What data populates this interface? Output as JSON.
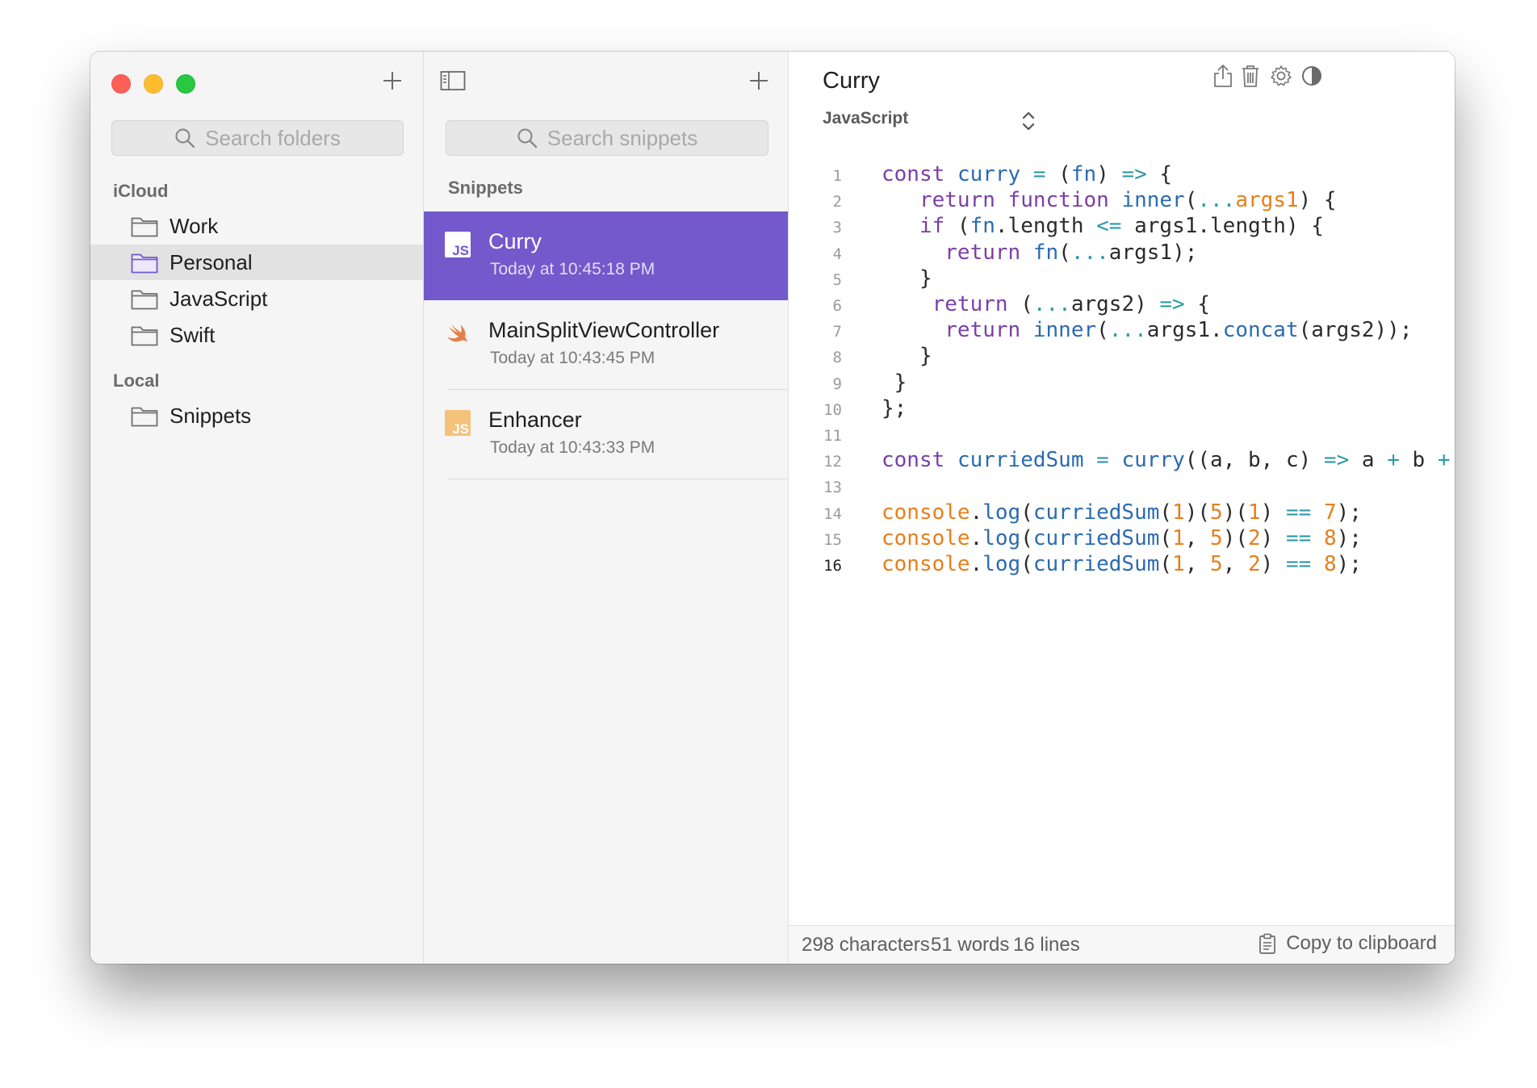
{
  "folders": {
    "search_placeholder": "Search folders",
    "icloud_label": "iCloud",
    "icloud_items": [
      {
        "label": "Work"
      },
      {
        "label": "Personal"
      },
      {
        "label": "JavaScript"
      },
      {
        "label": "Swift"
      }
    ],
    "selected_folder": "Personal",
    "local_label": "Local",
    "local_items": [
      {
        "label": "Snippets"
      }
    ]
  },
  "snippets": {
    "search_placeholder": "Search snippets",
    "header": "Snippets",
    "items": [
      {
        "title": "Curry",
        "date": "Today at 10:45:18 PM",
        "icon": "javascript-file-icon"
      },
      {
        "title": "MainSplitViewController",
        "date": "Today at 10:43:45 PM",
        "icon": "swift-logo-icon"
      },
      {
        "title": "Enhancer",
        "date": "Today at 10:43:33 PM",
        "icon": "javascript-file-icon"
      }
    ],
    "selected_index": 0
  },
  "editor": {
    "title": "Curry",
    "language": "JavaScript",
    "current_line": 16,
    "lines": [
      "const curry = (fn) => {",
      "   return function inner(...args1) {",
      "   if (fn.length <= args1.length) {",
      "     return fn(...args1);",
      "   }",
      "    return (...args2) => {",
      "     return inner(...args1.concat(args2));",
      "   }",
      " }",
      "};",
      "",
      "const curriedSum = curry((a, b, c) => a + b + c);",
      "",
      "console.log(curriedSum(1)(5)(1) == 7);",
      "console.log(curriedSum(1, 5)(2) == 8);",
      "console.log(curriedSum(1, 5, 2) == 8);"
    ],
    "line_numbers": [
      "1",
      "2",
      "3",
      "4",
      "5",
      "6",
      "7",
      "8",
      "9",
      "10",
      "11",
      "12",
      "13",
      "14",
      "15",
      "16"
    ]
  },
  "status": {
    "characters": "298 characters",
    "words": "51 words",
    "lines": "16 lines",
    "copy_label": "Copy to clipboard"
  },
  "colors": {
    "accent": "#7359cb",
    "keyword": "#7b3fa8",
    "function": "#2b6bb0",
    "operator": "#2c9aa6",
    "number": "#e67f1a"
  }
}
